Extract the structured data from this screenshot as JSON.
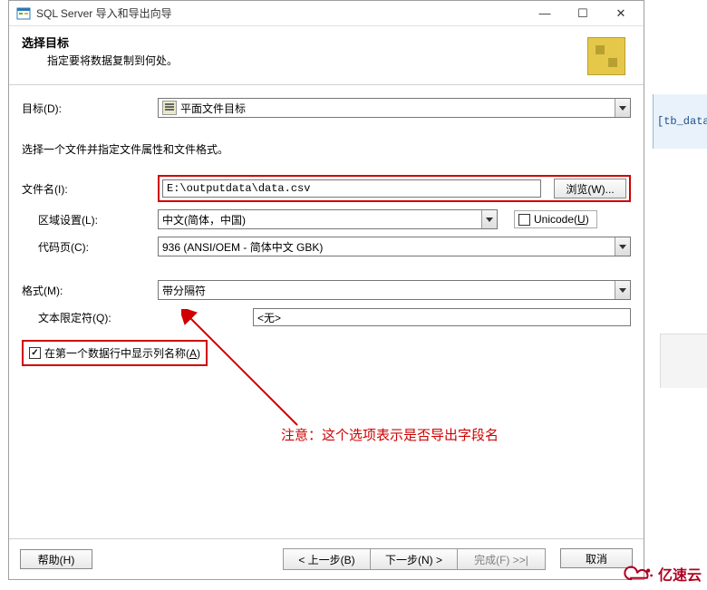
{
  "window": {
    "title": "SQL Server 导入和导出向导"
  },
  "header": {
    "title": "选择目标",
    "subtitle": "指定要将数据复制到何处。"
  },
  "labels": {
    "destination": "目标(D):",
    "hint": "选择一个文件并指定文件属性和文件格式。",
    "filename": "文件名(I):",
    "locale": "区域设置(L):",
    "codepage": "代码页(C):",
    "format": "格式(M):",
    "textQualifier": "文本限定符(Q):",
    "unicode": "Unicode(U)",
    "firstRowColumns": "在第一个数据行中显示列名称(A)"
  },
  "values": {
    "destination": "平面文件目标",
    "filename": "E:\\outputdata\\data.csv",
    "browse": "浏览(W)...",
    "locale": "中文(简体，中国)",
    "codepage": "936  (ANSI/OEM - 简体中文 GBK)",
    "format": "带分隔符",
    "textQualifier": "<无>"
  },
  "annotation": {
    "text": "注意：这个选项表示是否导出字段名"
  },
  "footer": {
    "help": "帮助(H)",
    "back": "< 上一步(B)",
    "next": "下一步(N) >",
    "finish": "完成(F) >>|",
    "cancel": "取消"
  },
  "side": {
    "fragment": "[tb_data"
  },
  "watermark": {
    "text": "亿速云"
  }
}
